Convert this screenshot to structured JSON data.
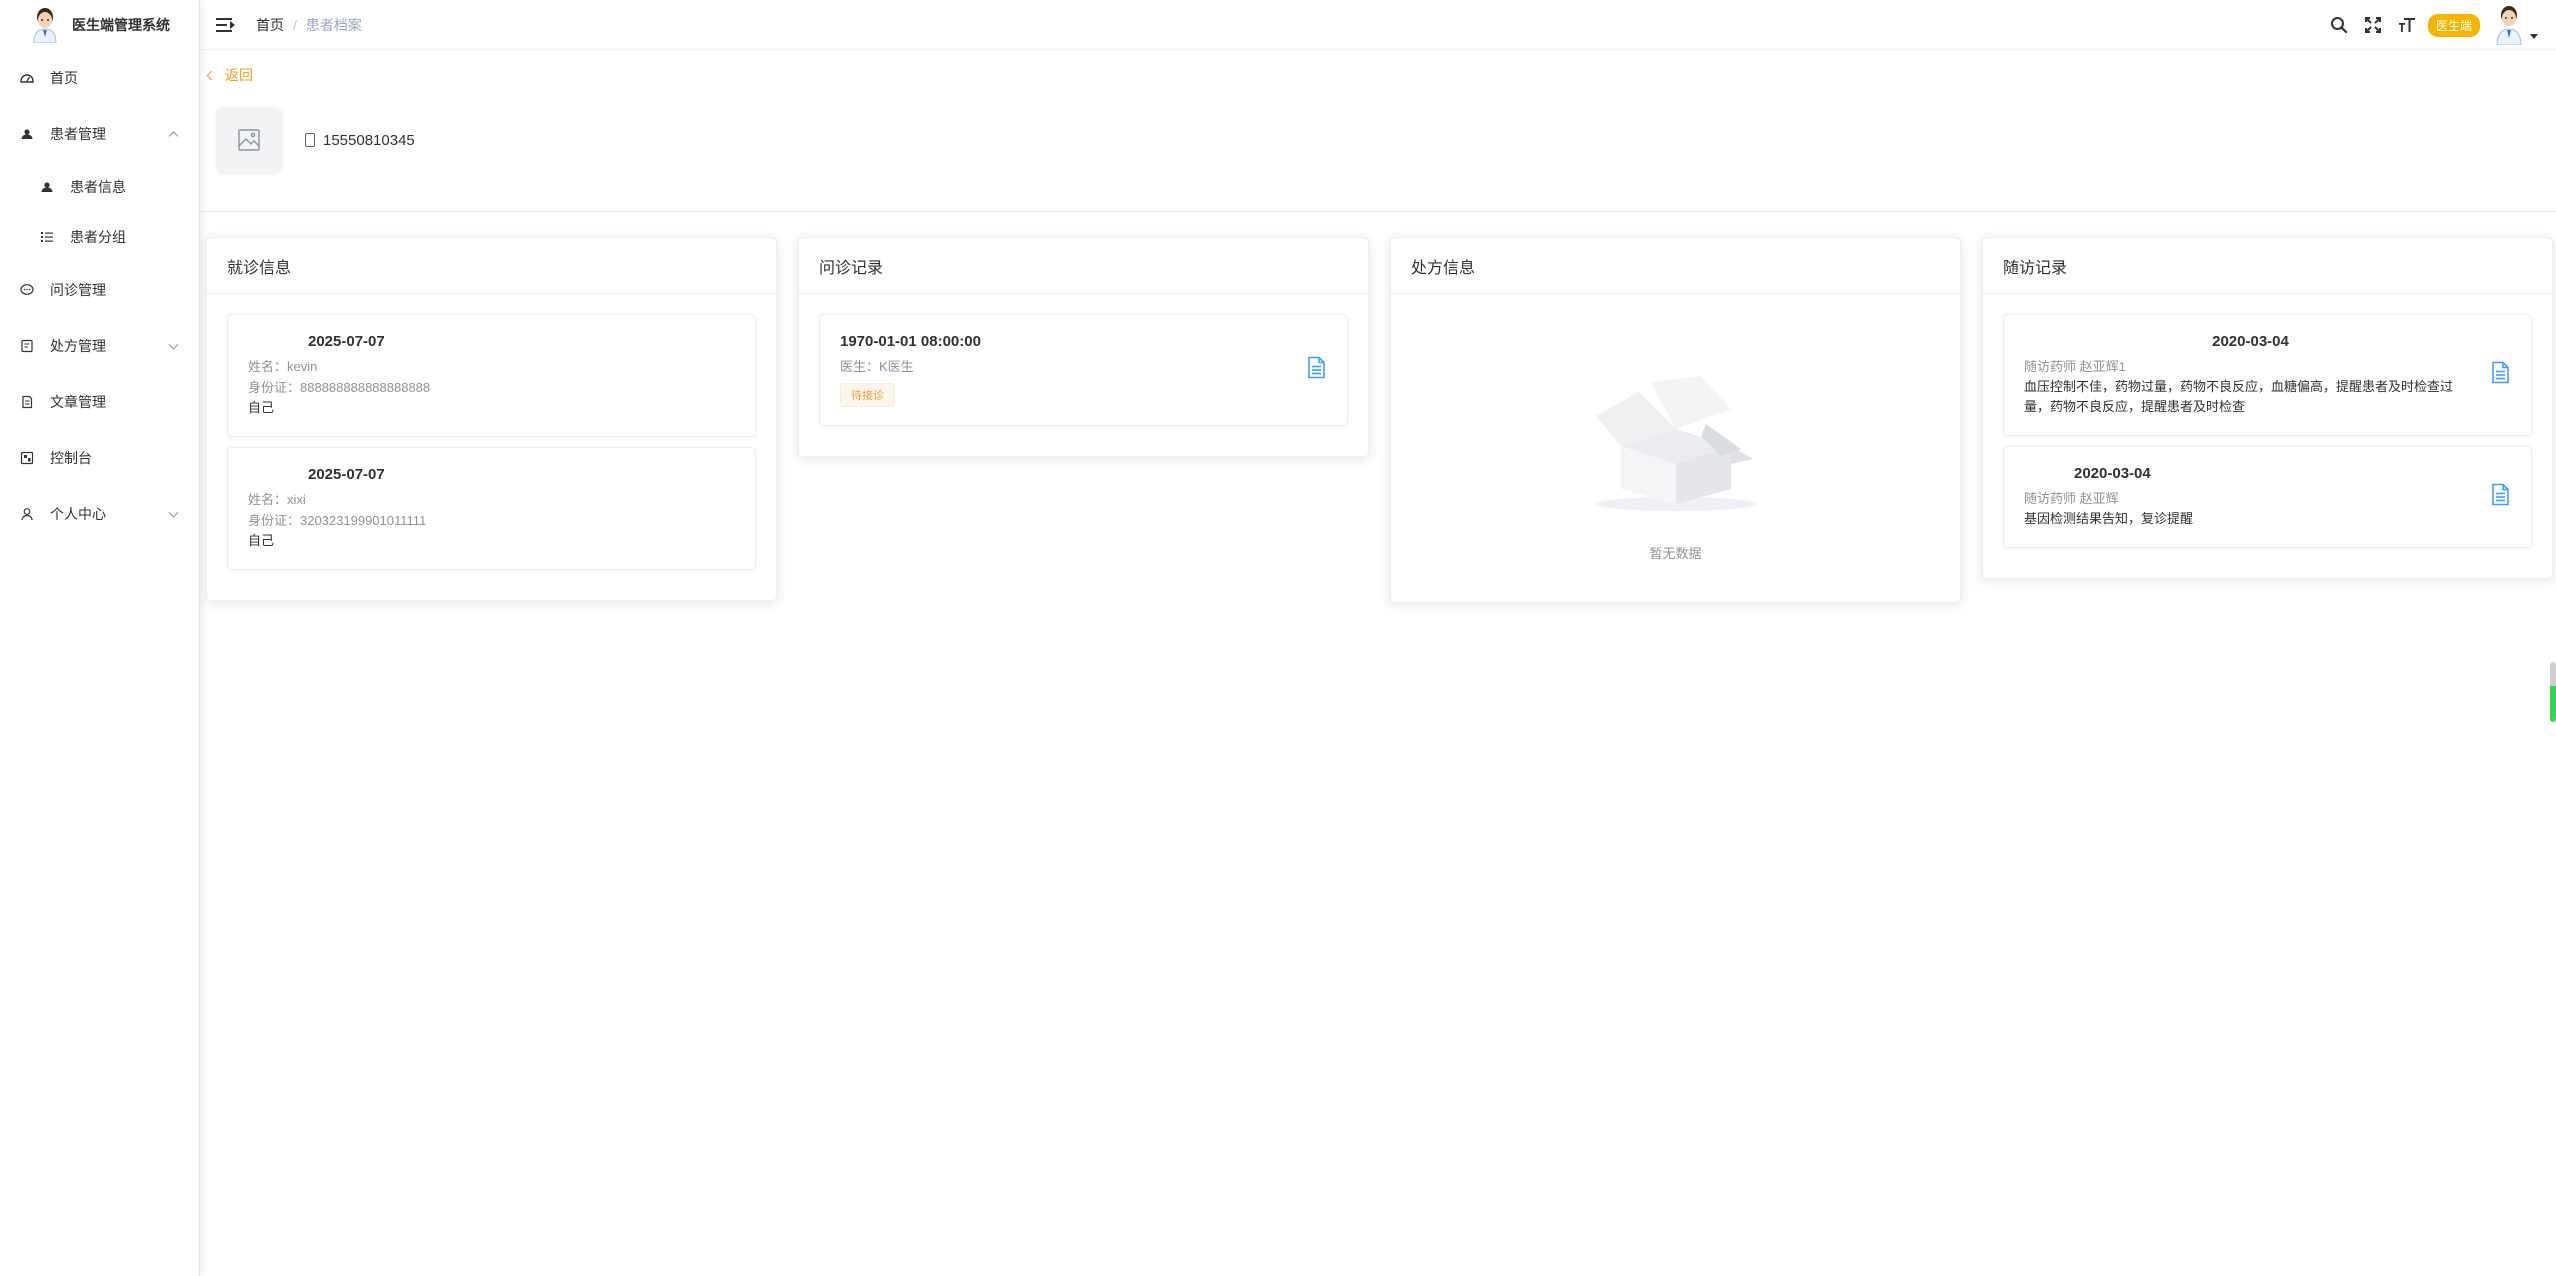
{
  "app": {
    "title": "医生端管理系统"
  },
  "sidebar": {
    "items": [
      {
        "label": "首页",
        "icon": "dashboard-icon"
      },
      {
        "label": "患者管理",
        "icon": "patient-icon",
        "expanded": true,
        "children": [
          {
            "label": "患者信息",
            "icon": "patient-icon"
          },
          {
            "label": "患者分组",
            "icon": "list-icon"
          }
        ]
      },
      {
        "label": "问诊管理",
        "icon": "chat-icon"
      },
      {
        "label": "处方管理",
        "icon": "prescription-icon",
        "expanded": false
      },
      {
        "label": "文章管理",
        "icon": "article-icon"
      },
      {
        "label": "控制台",
        "icon": "console-icon"
      },
      {
        "label": "个人中心",
        "icon": "user-icon",
        "expanded": false
      }
    ]
  },
  "header": {
    "breadcrumb": {
      "home": "首页",
      "separator": "/",
      "current": "患者档案"
    },
    "role_badge": "医生端",
    "badge_color": "#f7b500"
  },
  "main": {
    "back_label": "返回",
    "profile": {
      "phone": "15550810345"
    },
    "cards": {
      "visit": {
        "title": "就诊信息",
        "items": [
          {
            "date": "2025-07-07",
            "name_line": "姓名：kevin",
            "id_line": "身份证：888888888888888888",
            "relation": "自己"
          },
          {
            "date": "2025-07-07",
            "name_line": "姓名：xixi",
            "id_line": "身份证：320323199901011111",
            "relation": "自己"
          }
        ]
      },
      "consult": {
        "title": "问诊记录",
        "items": [
          {
            "datetime": "1970-01-01 08:00:00",
            "doctor_line": "医生：K医生",
            "status": "待接诊"
          }
        ]
      },
      "prescription": {
        "title": "处方信息",
        "empty_text": "暂无数据"
      },
      "followup": {
        "title": "随访记录",
        "items": [
          {
            "date": "2020-03-04",
            "pharmacist_line": "随访药师 赵亚辉1",
            "content": "血压控制不佳，药物过量，药物不良反应，血糖偏高，提醒患者及时检查过量，药物不良反应，提醒患者及时检查"
          },
          {
            "date": "2020-03-04",
            "pharmacist_line": "随访药师 赵亚辉",
            "content": "基因检测结果告知，复诊提醒"
          }
        ]
      }
    }
  },
  "colors": {
    "accent": "#f0a020",
    "doc_icon": "#409eff",
    "tag_warning": "#e6a23c"
  }
}
